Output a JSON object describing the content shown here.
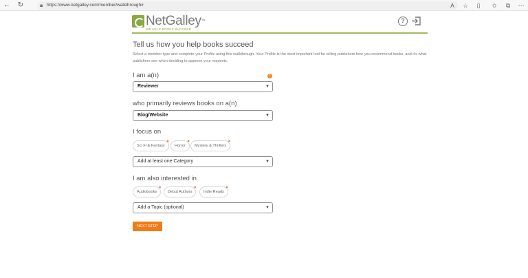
{
  "browser": {
    "url": "https://www.netgalley.com/member/walkthrough#",
    "icons": [
      "back-icon",
      "refresh-icon",
      "lock-icon",
      "read-aloud-icon",
      "favorite-star-icon",
      "split-screen-icon",
      "favorites-icon",
      "collections-icon",
      "more-icon"
    ]
  },
  "header": {
    "logo_name": "NetGalley",
    "logo_tm": "™",
    "logo_tagline": "WE HELP BOOKS SUCCEED",
    "brand_color": "#8aa840"
  },
  "intro": {
    "title": "Tell us how you help books succeed",
    "text": "Select a member type and complete your Profile using this walkthrough. Your Profile is the most important tool for telling publishers how you recommend books, and it's what publishers see when deciding to approve your requests."
  },
  "form": {
    "member_type": {
      "label": "I am a(n)",
      "value": "Reviewer"
    },
    "review_medium": {
      "label": "who primarily reviews books on a(n)",
      "value": "Blog/Website"
    },
    "focus": {
      "label": "I focus on",
      "tags": [
        "Sci Fi & Fantasy",
        "Horror",
        "Mystery & Thrillers"
      ],
      "select_placeholder": "Add at least one Category"
    },
    "interests": {
      "label": "I am also interested in",
      "tags": [
        "Audiobooks",
        "Debut Authors",
        "Indie Reads"
      ],
      "select_placeholder": "Add a Topic (optional)"
    },
    "next_label": "NEXT STEP",
    "accent_color": "#f07c18"
  }
}
